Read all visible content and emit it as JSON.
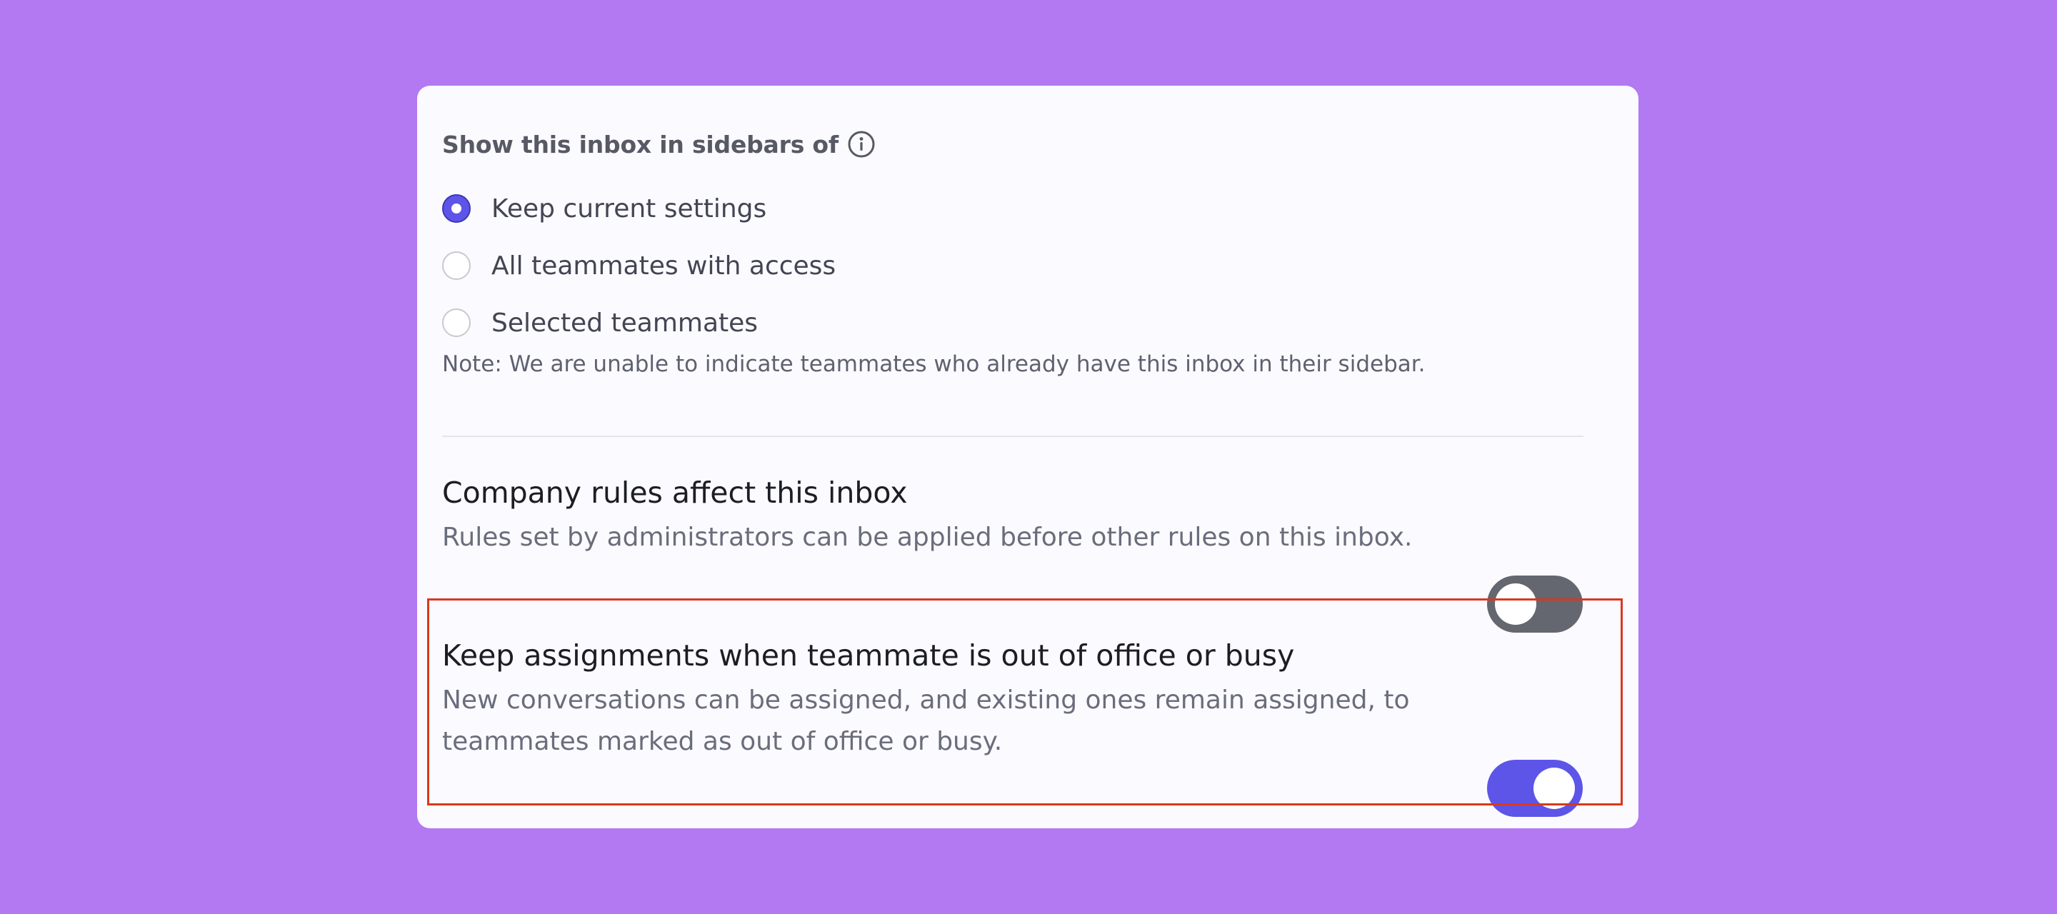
{
  "sidebar_visibility": {
    "heading": "Show this inbox in sidebars of",
    "info_icon": "info-circle-icon",
    "options": [
      {
        "label": "Keep current settings",
        "selected": true
      },
      {
        "label": "All teammates with access",
        "selected": false
      },
      {
        "label": "Selected teammates",
        "selected": false
      }
    ],
    "note": "Note: We are unable to indicate teammates who already have this inbox in their sidebar."
  },
  "company_rules": {
    "title": "Company rules affect this inbox",
    "description": "Rules set by administrators can be applied before other rules on this inbox.",
    "enabled": false
  },
  "keep_assignments": {
    "title": "Keep assignments when teammate is out of office or busy",
    "description": "New conversations can be assigned, and existing ones remain assigned, to teammates marked as out of office or busy.",
    "enabled": true
  },
  "colors": {
    "background": "#b279f2",
    "accent": "#5d55e8",
    "toggle_off": "#646770",
    "highlight": "#d9381e"
  }
}
